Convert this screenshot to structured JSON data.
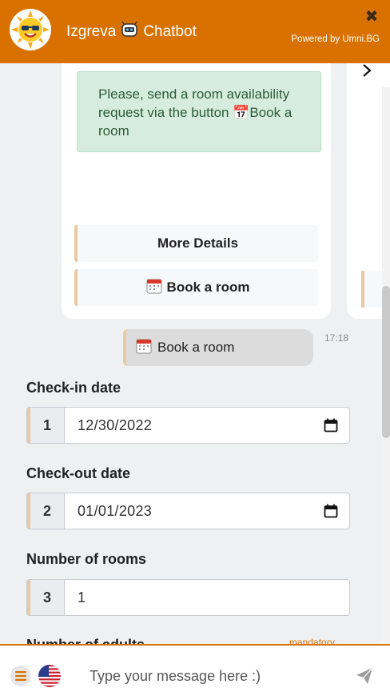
{
  "header": {
    "title_part1": "Izgreva",
    "title_part2": "Chatbot",
    "powered_by": "Powered by Umni.BG",
    "close_glyph": "✖"
  },
  "card": {
    "message": "Please, send a room availability request via the button 📅Book a room",
    "buttons": [
      {
        "label": "More Details"
      },
      {
        "label": "Book a room"
      }
    ]
  },
  "user_message": {
    "text": "Book a room",
    "time": "17:18"
  },
  "form": {
    "checkin": {
      "label": "Check-in date",
      "index": "1",
      "value": "12/30/2022"
    },
    "checkout": {
      "label": "Check-out date",
      "index": "2",
      "value": "01/01/2023"
    },
    "rooms": {
      "label": "Number of rooms",
      "index": "3",
      "value": "1"
    },
    "adults": {
      "label": "Number of adults",
      "mandatory": "mandatory"
    }
  },
  "composer": {
    "placeholder": "Type your message here :)"
  },
  "colors": {
    "brand": "#d97100",
    "accent_border": "#e7c9a2",
    "success_bg": "#d6eddd"
  }
}
